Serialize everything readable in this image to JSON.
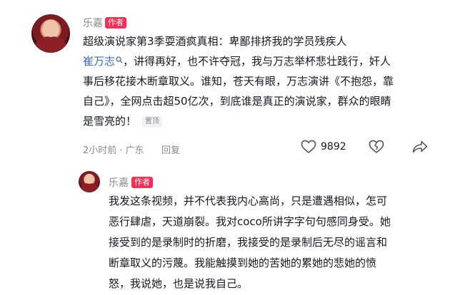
{
  "comment": {
    "author": "乐嘉",
    "author_badge": "作者",
    "text_line1": "超级演说家第3季耍酒疯真相：卑鄙排挤我的学员残疾人",
    "mention": "崔万志",
    "text_line2_rest": "，讲得再好，也不许夺冠，我与万志举杯悲壮践行，奸人",
    "text_line3": "事后移花接木断章取义。谁知，苍天有眼，万志演讲《不抱怨，靠",
    "text_line4": "自己》，全网点击超50亿次，到底谁是真正的演说家，群众的眼睛",
    "text_line5": "是雪亮的！",
    "pinned_label": "置顶",
    "time_location": "2小时前 · 广东",
    "reply_label": "回复",
    "like_count": "9892"
  },
  "reply": {
    "author": "乐嘉",
    "author_badge": "作者",
    "lines": [
      "我发这条视频，并不代表我内心高尚，只是遭遇相似，怎可",
      "恶行肆虐，天道崩裂。我对coco所讲字字句句感同身受。她",
      "接受到的是录制时的折磨，我接受的是录制后无尽的谣言和",
      "断章取义的污蔑。我能触摸到她的苦她的累她的悲她的愤",
      "怒，我说她，也是说我自己。"
    ]
  }
}
